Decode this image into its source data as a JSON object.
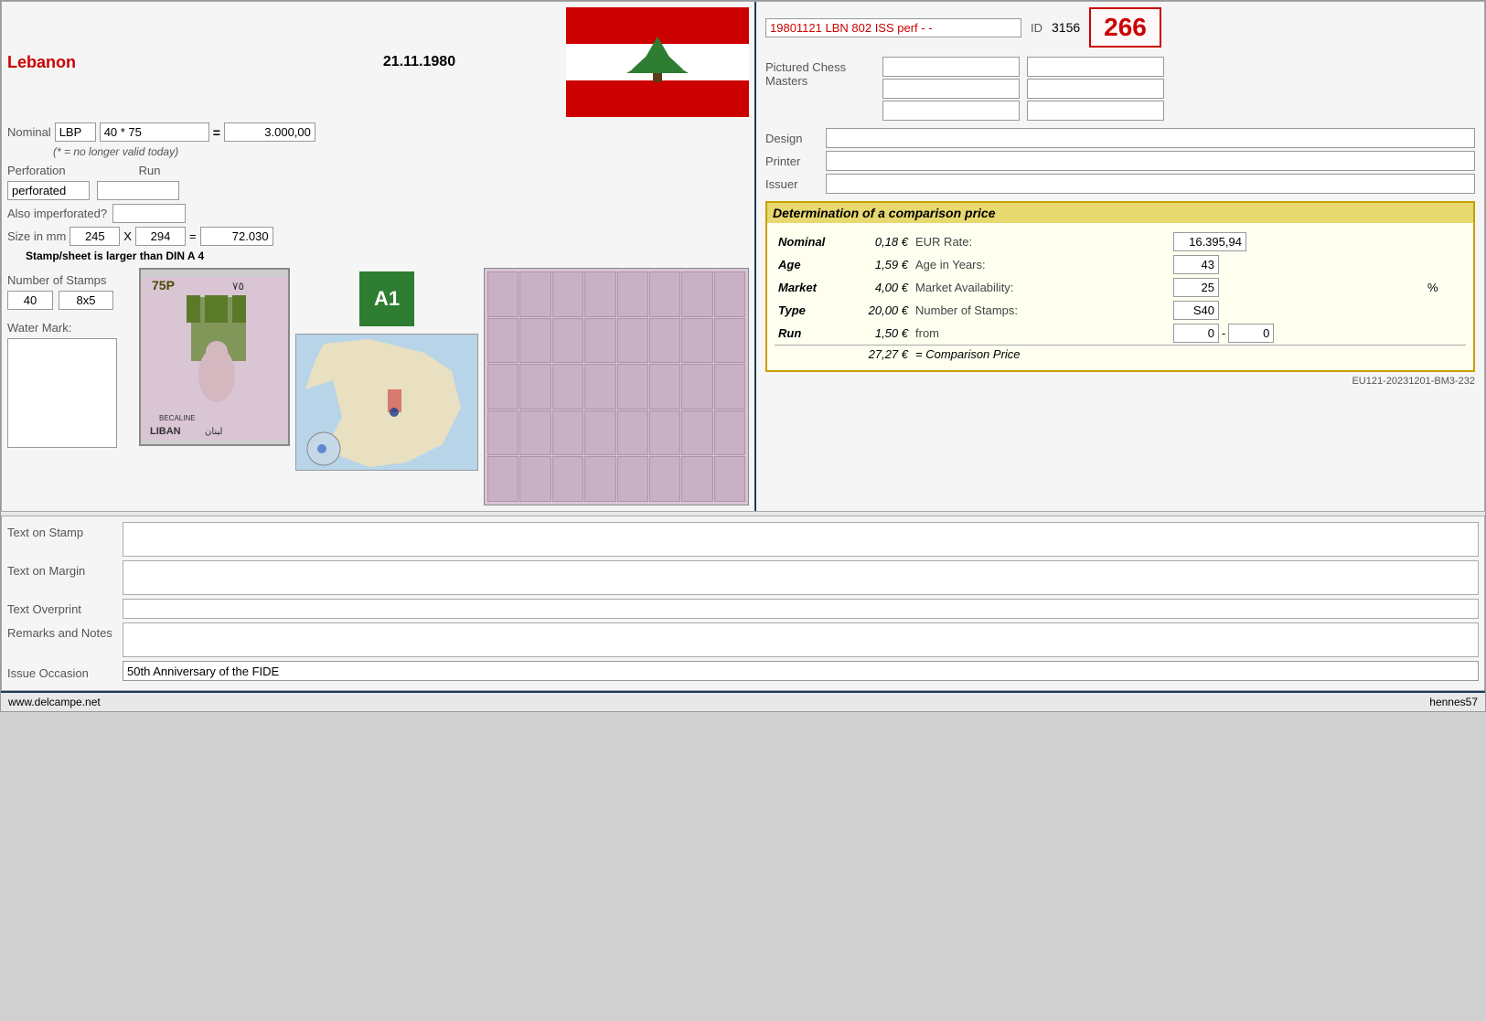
{
  "header": {
    "country": "Lebanon",
    "date": "21.11.1980"
  },
  "nominal": {
    "label": "Nominal",
    "currency": "LBP",
    "value": "40 * 75",
    "equals": "=",
    "result": "3.000,00",
    "note": "(* = no longer valid today)"
  },
  "perforation": {
    "label": "Perforation",
    "run_label": "Run",
    "perf_value": "perforated",
    "run_value": "",
    "also_imp_label": "Also imperforated?",
    "also_imp_value": ""
  },
  "size": {
    "label": "Size in mm",
    "w": "245",
    "x": "X",
    "h": "294",
    "equals": "=",
    "result": "72.030",
    "note": "Stamp/sheet is larger than DIN A 4"
  },
  "stamps": {
    "label": "Number of Stamps",
    "count": "40",
    "layout": "8x5"
  },
  "watermark": {
    "label": "Water Mark:"
  },
  "a1_badge": "A1",
  "stamp_id": {
    "code": "19801121 LBN 802 ISS perf - -",
    "id_label": "ID",
    "id_number": "3156",
    "score": "266"
  },
  "pictured": {
    "label": "Pictured Chess Masters",
    "inputs": [
      "",
      "",
      "",
      "",
      "",
      ""
    ]
  },
  "design": {
    "label": "Design",
    "value": ""
  },
  "printer": {
    "label": "Printer",
    "value": ""
  },
  "issuer": {
    "label": "Issuer",
    "value": ""
  },
  "comparison": {
    "title": "Determination of a comparison price",
    "rows": [
      {
        "label": "Nominal",
        "value": "0,18 €",
        "label2": "EUR Rate:",
        "input": "16.395,94"
      },
      {
        "label": "Age",
        "value": "1,59 €",
        "label2": "Age in Years:",
        "input": "43"
      },
      {
        "label": "Market",
        "value": "4,00 €",
        "label2": "Market Availability:",
        "input": "25",
        "pct": "%"
      },
      {
        "label": "Type",
        "value": "20,00 €",
        "label2": "Number of Stamps:",
        "input": "S40"
      },
      {
        "label": "Run",
        "value": "1,50 €",
        "label2": "from",
        "from_val": "0",
        "dash": "-",
        "to_val": "0"
      }
    ],
    "total_value": "27,27 €",
    "total_label": "= Comparison Price"
  },
  "eu_code": "EU121-20231201-BM3-232",
  "text_fields": {
    "text_on_stamp_label": "Text on Stamp",
    "text_on_stamp_value": "",
    "text_on_margin_label": "Text on Margin",
    "text_on_margin_value": "",
    "text_overprint_label": "Text Overprint",
    "text_overprint_value": "",
    "remarks_label": "Remarks and Notes",
    "remarks_value": "",
    "issue_occasion_label": "Issue Occasion",
    "issue_occasion_value": "50th Anniversary of the FIDE"
  },
  "footer": {
    "left": "www.delcampe.net",
    "right": "hennes57"
  }
}
